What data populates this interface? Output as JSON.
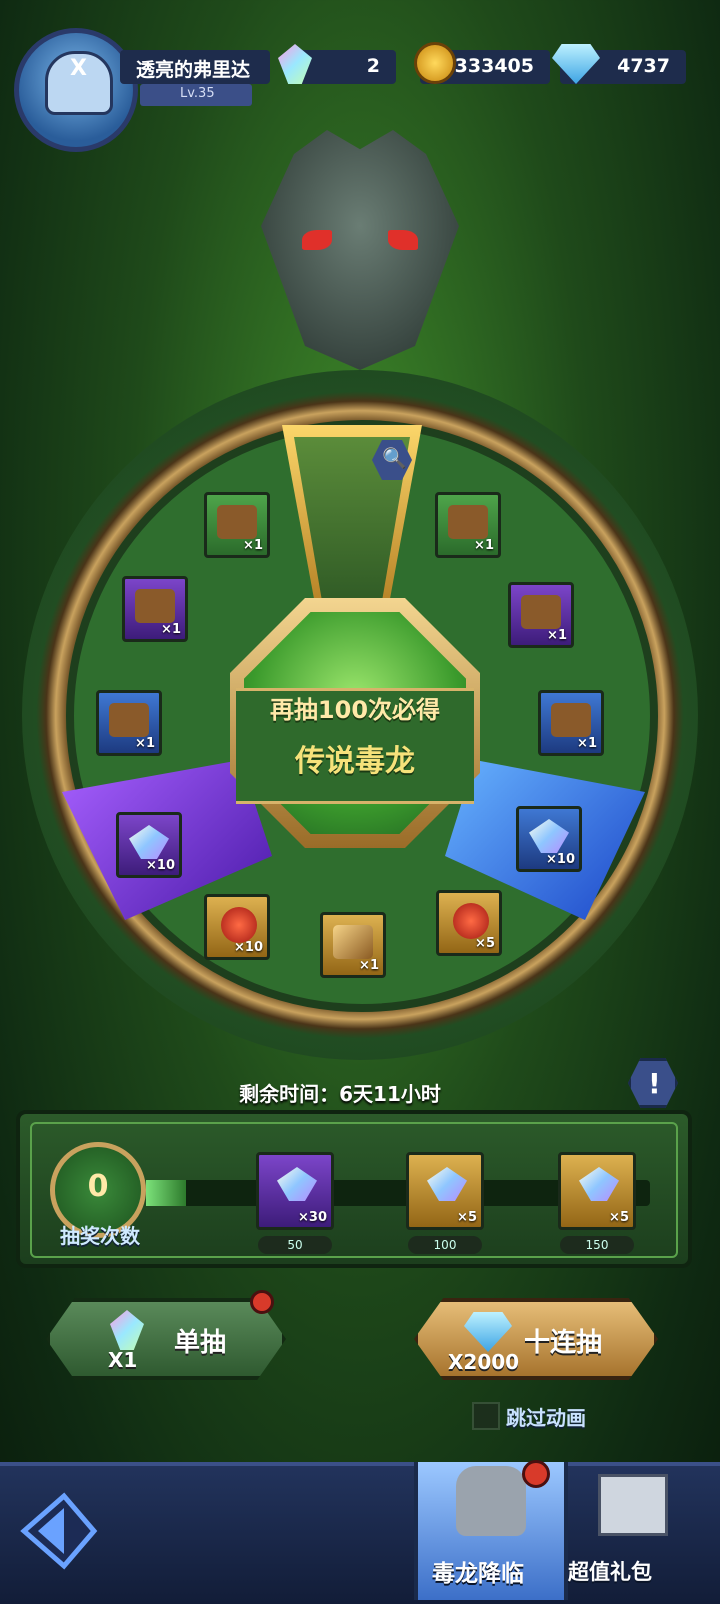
{
  "player": {
    "name": "透亮的弗里达",
    "level": "Lv.35",
    "badge_text": "X"
  },
  "resources": {
    "gems": "2",
    "gold": "333405",
    "diamonds": "4737"
  },
  "wheel": {
    "center_line1": "再抽100次必得",
    "center_line2": "传说毒龙",
    "slots": [
      {
        "icon": "treasure-chest-mystery-icon",
        "count": "×1",
        "rarity": "green"
      },
      {
        "icon": "treasure-chest-icon",
        "count": "×1",
        "rarity": "green"
      },
      {
        "icon": "treasure-chest-mystery-icon",
        "count": "×1",
        "rarity": "purple"
      },
      {
        "icon": "treasure-chest-icon",
        "count": "×1",
        "rarity": "purple"
      },
      {
        "icon": "treasure-chest-mystery-icon",
        "count": "×1",
        "rarity": "blue"
      },
      {
        "icon": "treasure-chest-icon",
        "count": "×1",
        "rarity": "blue"
      },
      {
        "icon": "purple-crystal-icon",
        "count": "×10",
        "rarity": "purple"
      },
      {
        "icon": "blue-crystal-icon",
        "count": "×10",
        "rarity": "blue"
      },
      {
        "icon": "red-rune-icon",
        "count": "×10",
        "rarity": "gold"
      },
      {
        "icon": "scroll-icon",
        "count": "×1",
        "rarity": "gold"
      },
      {
        "icon": "red-rune-icon",
        "count": "×5",
        "rarity": "gold"
      }
    ]
  },
  "timer": "剩余时间：6天11小时",
  "progress": {
    "draw_count": "0",
    "draw_label": "抽奖次数",
    "fill_fraction": 0,
    "milestones": [
      {
        "count": "×30",
        "threshold": "50",
        "icon": "purple-crystal-icon"
      },
      {
        "count": "×5",
        "threshold": "100",
        "icon": "rainbow-crystal-icon"
      },
      {
        "count": "×5",
        "threshold": "150",
        "icon": "rainbow-crystal-icon"
      }
    ]
  },
  "buttons": {
    "single_label": "单抽",
    "single_cost": "X1",
    "ten_label": "十连抽",
    "ten_cost": "X2000",
    "skip_label": "跳过动画"
  },
  "nav": {
    "tab_event": "毒龙降临",
    "tab_gift": "超值礼包"
  }
}
